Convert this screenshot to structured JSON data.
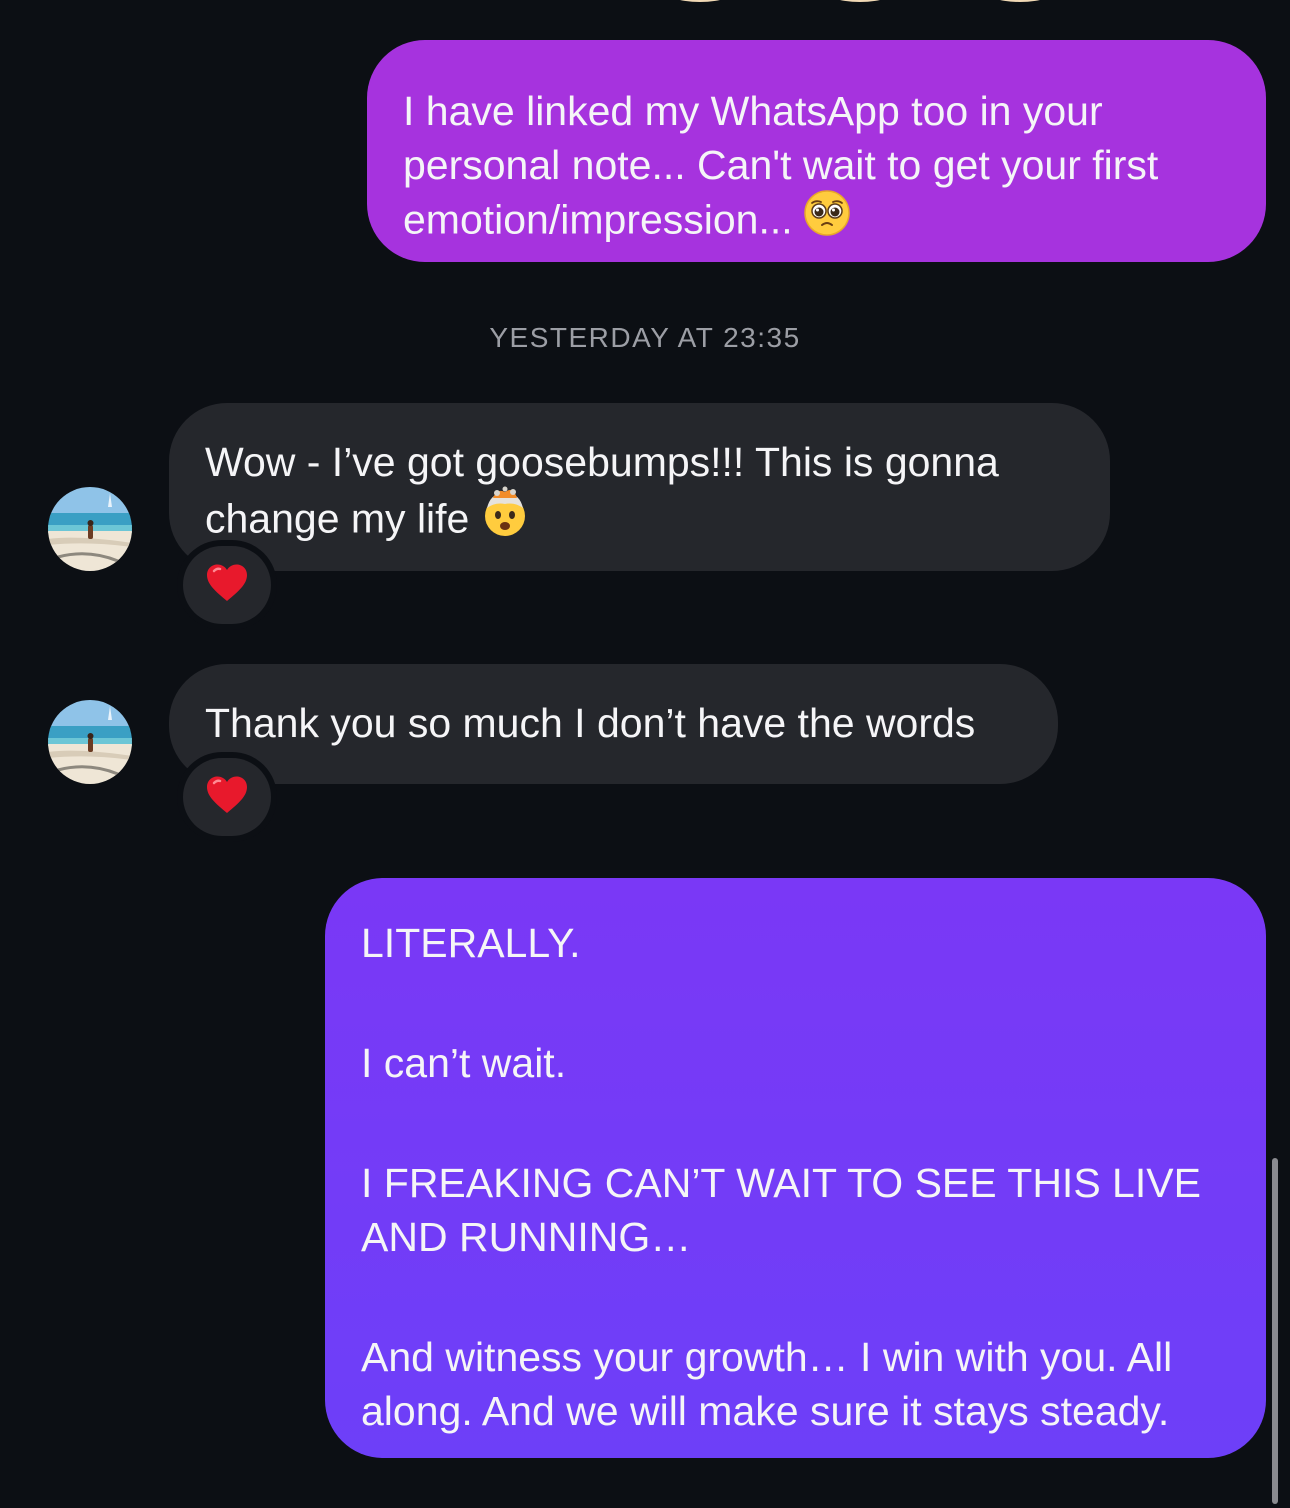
{
  "colors": {
    "background": "#0c0f14",
    "outgoing_bubble_1": "#a633de",
    "outgoing_bubble_2": "#7a38f6",
    "incoming_bubble": "#25272c",
    "timestamp_text": "#9c9ea5"
  },
  "thread": {
    "outgoing_1": {
      "text": "I have linked my WhatsApp too in your personal note... Can't wait to get your first emotion/impression...",
      "emoji": "pleading-face-icon"
    },
    "timestamp": "YESTERDAY AT 23:35",
    "incoming_1": {
      "text": "Wow - I’ve got goosebumps!!!  This is gonna change my life",
      "emoji": "exploding-head-icon",
      "reaction": "heart-icon"
    },
    "incoming_2": {
      "text": "Thank you so much I don’t have the words",
      "reaction": "heart-icon"
    },
    "outgoing_2": {
      "paragraphs": [
        "LITERALLY.",
        "I can’t wait.",
        "I FREAKING CAN’T WAIT TO SEE THIS LIVE AND RUNNING…",
        "And witness your growth… I win with you. All along. And we will make sure it stays steady."
      ]
    }
  }
}
